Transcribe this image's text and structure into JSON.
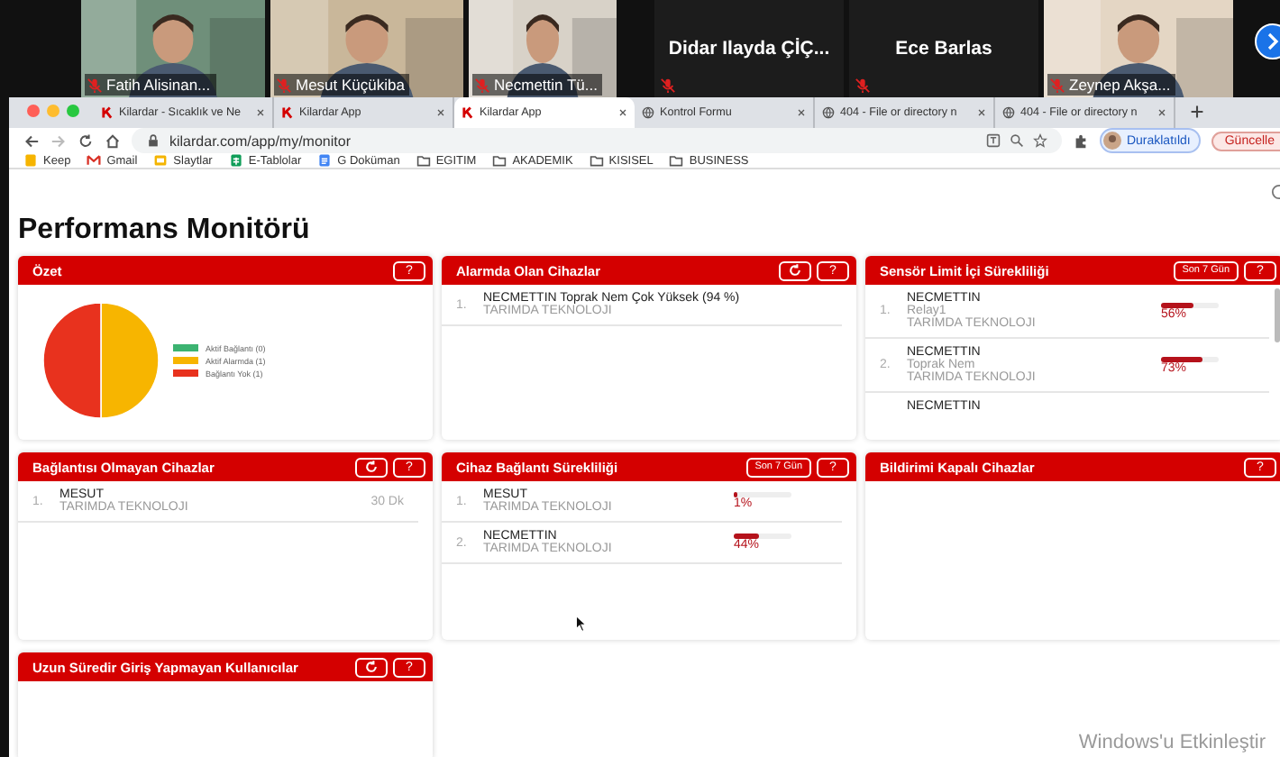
{
  "call": {
    "participants": [
      {
        "name": "Fatih Alisinan...",
        "kind": "video"
      },
      {
        "name": "Mesut Küçükiba",
        "kind": "video"
      },
      {
        "name": "Necmettin Tü...",
        "kind": "video"
      },
      {
        "name": "Didar Ilayda ÇİÇ...",
        "kind": "name_only"
      },
      {
        "name": "Ece Barlas",
        "kind": "name_only"
      },
      {
        "name": "Zeynep Akşa...",
        "kind": "video"
      }
    ]
  },
  "browser": {
    "tabs": [
      {
        "label": "Kilardar - Sıcaklık ve Ne",
        "kind": "kilardar",
        "selected": false
      },
      {
        "label": "Kilardar App",
        "kind": "kilardar",
        "selected": false
      },
      {
        "label": "Kilardar App",
        "kind": "kilardar",
        "selected": true
      },
      {
        "label": "Kontrol Formu",
        "kind": "globe",
        "selected": false
      },
      {
        "label": "404 - File or directory n",
        "kind": "globe",
        "selected": false
      },
      {
        "label": "404 - File or directory n",
        "kind": "globe",
        "selected": false
      }
    ],
    "address": "kilardar.com/app/my/monitor",
    "profile": "Duraklatıldı",
    "update": "Güncelle",
    "bookmarks": [
      {
        "label": "Keep",
        "kind": "keep"
      },
      {
        "label": "Gmail",
        "kind": "gmail"
      },
      {
        "label": "Slaytlar",
        "kind": "slides"
      },
      {
        "label": "E-Tablolar",
        "kind": "sheets"
      },
      {
        "label": "G Doküman",
        "kind": "docs"
      },
      {
        "label": "EGITIM",
        "kind": "folder"
      },
      {
        "label": "AKADEMIK",
        "kind": "folder"
      },
      {
        "label": "KISISEL",
        "kind": "folder"
      },
      {
        "label": "BUSINESS",
        "kind": "folder"
      }
    ]
  },
  "page": {
    "title": "Performans Monitörü",
    "cards": [
      {
        "title": "Özet",
        "refresh": false,
        "help": "?",
        "kind": "pie",
        "chart_data": {
          "type": "pie",
          "categories": [
            "Aktif Bağlantı (0)",
            "Aktif Alarmda (1)",
            "Bağlantı Yok (1)"
          ],
          "values": [
            0,
            1,
            1
          ],
          "colors": [
            "#3cb371",
            "#f7b500",
            "#e8321e"
          ],
          "legend": "right"
        }
      },
      {
        "title": "Alarmda Olan Cihazlar",
        "refresh": true,
        "help": "?",
        "kind": "list",
        "items": [
          {
            "index": "1.",
            "name": "NECMETTIN Toprak Nem Çok Yüksek (94 %)",
            "company": "TARIMDA TEKNOLOJI"
          }
        ]
      },
      {
        "title": "Sensör Limit İçi Sürekliliği",
        "range": "Son 7 Gün",
        "help": "?",
        "kind": "list",
        "scroll": true,
        "items": [
          {
            "index": "1.",
            "name": "NECMETTIN",
            "sensor": "Relay1",
            "company": "TARIMDA TEKNOLOJI",
            "level": 0.56,
            "reading": "56%"
          },
          {
            "index": "2.",
            "name": "NECMETTIN",
            "sensor": "Toprak Nem",
            "company": "TARIMDA TEKNOLOJI",
            "level": 0.73,
            "reading": "73%"
          },
          {
            "name": "NECMETTIN"
          }
        ]
      },
      {
        "title": "Bağlantısı Olmayan Cihazlar",
        "refresh": true,
        "help": "?",
        "kind": "list",
        "items": [
          {
            "index": "1.",
            "name": "MESUT",
            "company": "TARIMDA TEKNOLOJI",
            "time": "30 Dk"
          }
        ]
      },
      {
        "title": "Cihaz Bağlantı Sürekliliği",
        "range": "Son 7 Gün",
        "help": "?",
        "kind": "list",
        "items": [
          {
            "index": "1.",
            "name": "MESUT",
            "company": "TARIMDA TEKNOLOJI",
            "level": 0.01,
            "reading": "1%"
          },
          {
            "index": "2.",
            "name": "NECMETTIN",
            "company": "TARIMDA TEKNOLOJI",
            "level": 0.44,
            "reading": "44%"
          }
        ]
      },
      {
        "title": "Bildirimi Kapalı Cihazlar",
        "help": "?",
        "kind": "list"
      },
      {
        "title": "Uzun Süredir Giriş Yapmayan Kullanıcılar",
        "refresh": true,
        "help": "?",
        "kind": "list"
      }
    ]
  },
  "os_notice": "Windows'u Etkinleştir"
}
